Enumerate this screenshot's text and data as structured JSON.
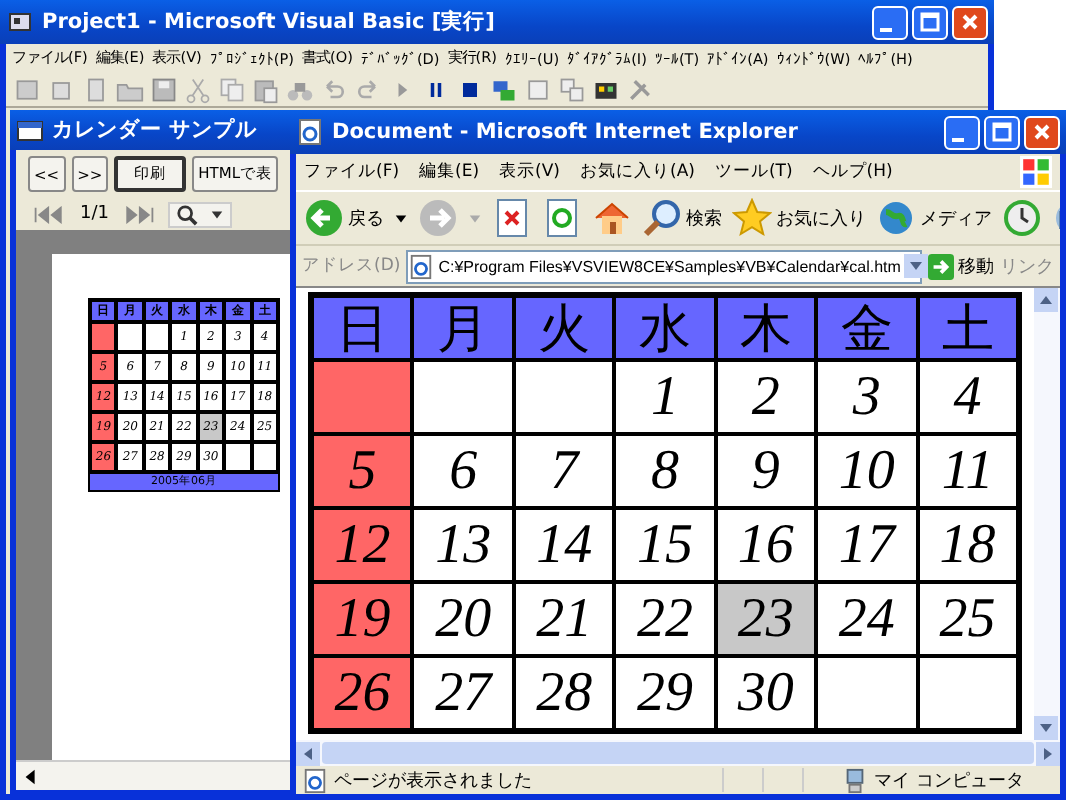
{
  "vb_window": {
    "title": "Project1 - Microsoft Visual Basic [実行]",
    "menu": [
      "ファイル(F)",
      "編集(E)",
      "表示(V)",
      "ﾌﾟﾛｼﾞｪｸﾄ(P)",
      "書式(O)",
      "ﾃﾞﾊﾞｯｸﾞ(D)",
      "実行(R)",
      "ｸｴﾘｰ(U)",
      "ﾀﾞｲｱｸﾞﾗﾑ(I)",
      "ﾂｰﾙ(T)",
      "ｱﾄﾞｲﾝ(A)",
      "ｳｨﾝﾄﾞｳ(W)",
      "ﾍﾙﾌﾟ(H)"
    ]
  },
  "calendar_window": {
    "title": "カレンダー サンプル",
    "buttons": [
      {
        "label": "<<",
        "default": false
      },
      {
        "label": ">>",
        "default": false
      },
      {
        "label": "印刷",
        "default": true
      },
      {
        "label": "HTMLで表",
        "default": false
      }
    ],
    "page_indicator": "1/1",
    "preview": {
      "weekdays": [
        "日",
        "月",
        "火",
        "水",
        "木",
        "金",
        "土"
      ],
      "weeks": [
        [
          {
            "kind": "sunday"
          },
          {
            "kind": "normal"
          },
          {
            "kind": "normal"
          },
          {
            "kind": "normal",
            "day": "1"
          },
          {
            "kind": "normal",
            "day": "2"
          },
          {
            "kind": "normal",
            "day": "3"
          },
          {
            "kind": "normal",
            "day": "4"
          }
        ],
        [
          {
            "kind": "sunday",
            "day": "5"
          },
          {
            "kind": "normal",
            "day": "6"
          },
          {
            "kind": "normal",
            "day": "7"
          },
          {
            "kind": "normal",
            "day": "8"
          },
          {
            "kind": "normal",
            "day": "9"
          },
          {
            "kind": "normal",
            "day": "10"
          },
          {
            "kind": "normal",
            "day": "11"
          }
        ],
        [
          {
            "kind": "sunday",
            "day": "12"
          },
          {
            "kind": "normal",
            "day": "13"
          },
          {
            "kind": "normal",
            "day": "14"
          },
          {
            "kind": "normal",
            "day": "15"
          },
          {
            "kind": "normal",
            "day": "16"
          },
          {
            "kind": "normal",
            "day": "17"
          },
          {
            "kind": "normal",
            "day": "18"
          }
        ],
        [
          {
            "kind": "sunday",
            "day": "19"
          },
          {
            "kind": "normal",
            "day": "20"
          },
          {
            "kind": "normal",
            "day": "21"
          },
          {
            "kind": "normal",
            "day": "22"
          },
          {
            "kind": "today",
            "day": "23"
          },
          {
            "kind": "normal",
            "day": "24"
          },
          {
            "kind": "normal",
            "day": "25"
          }
        ],
        [
          {
            "kind": "sunday",
            "day": "26"
          },
          {
            "kind": "normal",
            "day": "27"
          },
          {
            "kind": "normal",
            "day": "28"
          },
          {
            "kind": "normal",
            "day": "29"
          },
          {
            "kind": "normal",
            "day": "30"
          },
          {
            "kind": "normal"
          },
          {
            "kind": "normal"
          }
        ]
      ],
      "caption": "2005年06月"
    }
  },
  "ie_window": {
    "title": "Document - Microsoft Internet Explorer",
    "menu": [
      "ファイル(F)",
      "編集(E)",
      "表示(V)",
      "お気に入り(A)",
      "ツール(T)",
      "ヘルプ(H)"
    ],
    "toolbar": {
      "back": "戻る",
      "search": "検索",
      "favorites": "お気に入り",
      "media": "メディア"
    },
    "address_label": "アドレス(D)",
    "address": "C:¥Program Files¥VSVIEW8CE¥Samples¥VB¥Calendar¥cal.htm",
    "go": "移動",
    "links": "リンク",
    "calendar": {
      "weekdays": [
        "日",
        "月",
        "火",
        "水",
        "木",
        "金",
        "土"
      ],
      "weeks": [
        [
          {
            "kind": "sunday"
          },
          {
            "kind": "normal"
          },
          {
            "kind": "normal"
          },
          {
            "kind": "normal",
            "day": "1"
          },
          {
            "kind": "normal",
            "day": "2"
          },
          {
            "kind": "normal",
            "day": "3"
          },
          {
            "kind": "normal",
            "day": "4"
          }
        ],
        [
          {
            "kind": "sunday",
            "day": "5"
          },
          {
            "kind": "normal",
            "day": "6"
          },
          {
            "kind": "normal",
            "day": "7"
          },
          {
            "kind": "normal",
            "day": "8"
          },
          {
            "kind": "normal",
            "day": "9"
          },
          {
            "kind": "normal",
            "day": "10"
          },
          {
            "kind": "normal",
            "day": "11"
          }
        ],
        [
          {
            "kind": "sunday",
            "day": "12"
          },
          {
            "kind": "normal",
            "day": "13"
          },
          {
            "kind": "normal",
            "day": "14"
          },
          {
            "kind": "normal",
            "day": "15"
          },
          {
            "kind": "normal",
            "day": "16"
          },
          {
            "kind": "normal",
            "day": "17"
          },
          {
            "kind": "normal",
            "day": "18"
          }
        ],
        [
          {
            "kind": "sunday",
            "day": "19"
          },
          {
            "kind": "normal",
            "day": "20"
          },
          {
            "kind": "normal",
            "day": "21"
          },
          {
            "kind": "normal",
            "day": "22"
          },
          {
            "kind": "today",
            "day": "23"
          },
          {
            "kind": "normal",
            "day": "24"
          },
          {
            "kind": "normal",
            "day": "25"
          }
        ],
        [
          {
            "kind": "sunday",
            "day": "26"
          },
          {
            "kind": "normal",
            "day": "27"
          },
          {
            "kind": "normal",
            "day": "28"
          },
          {
            "kind": "normal",
            "day": "29"
          },
          {
            "kind": "normal",
            "day": "30"
          },
          {
            "kind": "normal"
          },
          {
            "kind": "normal"
          }
        ]
      ]
    },
    "status": "ページが表示されました",
    "zone": "マイ コンピュータ"
  }
}
